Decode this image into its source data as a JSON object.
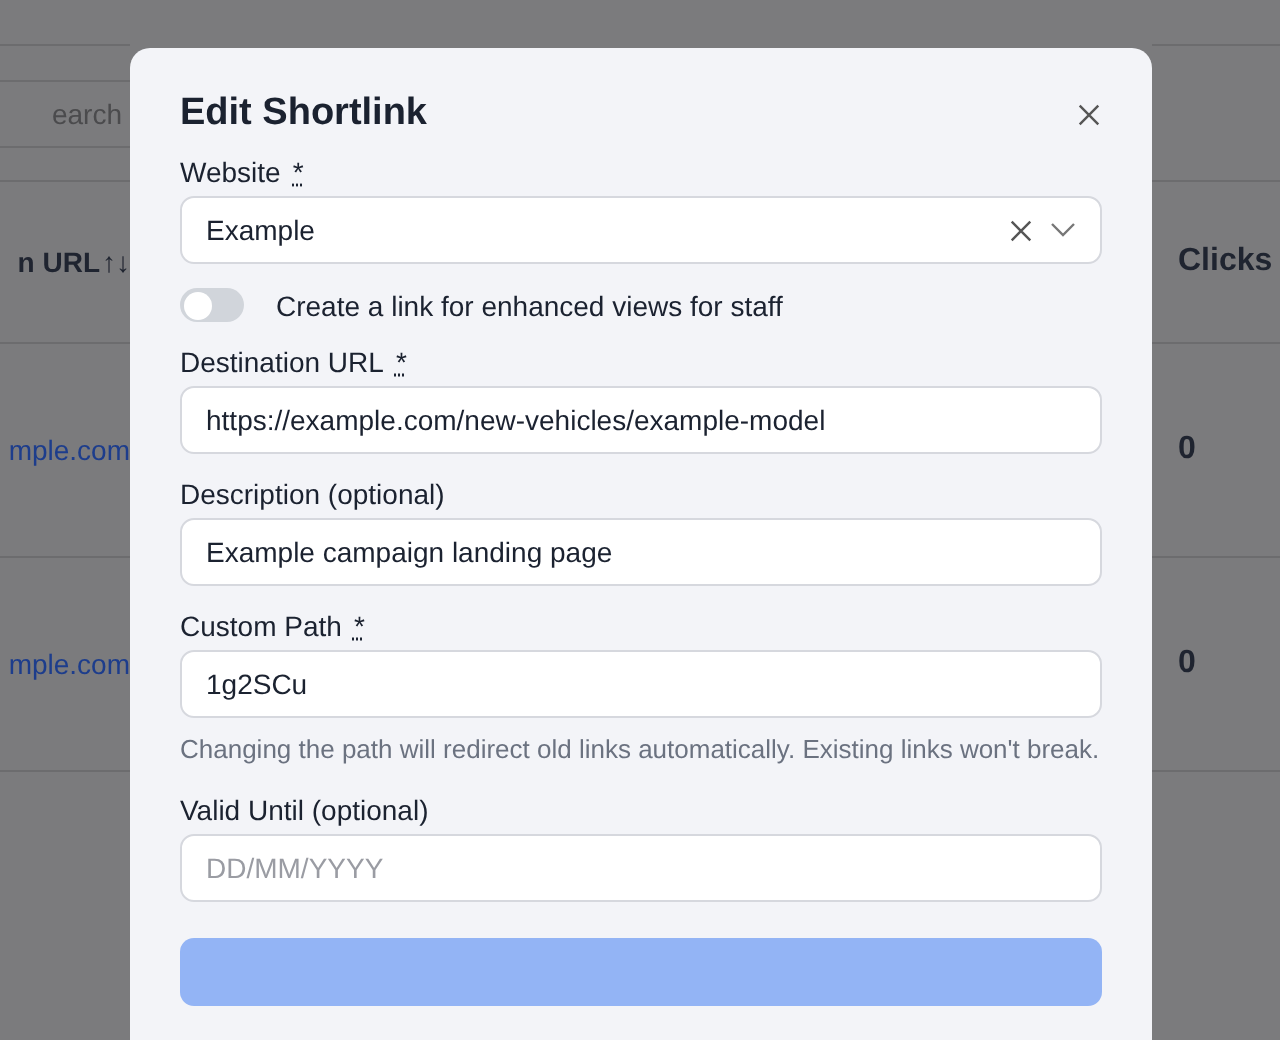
{
  "background_page": {
    "search": {
      "placeholder": "earch"
    },
    "table": {
      "columns": [
        {
          "label": "n URL",
          "sort_icon": "↑↓"
        },
        {
          "label": "Clicks"
        }
      ],
      "rows": [
        {
          "url": "mple.com",
          "clicks": "0"
        },
        {
          "url": "mple.com",
          "clicks": "0"
        }
      ]
    }
  },
  "dialog": {
    "title": "Edit Shortlink",
    "fields": [
      {
        "kind": "select",
        "label": "Website",
        "required": true,
        "value": "Example"
      },
      {
        "kind": "toggle",
        "label": "Create a link for enhanced views for staff",
        "on": false
      },
      {
        "kind": "text",
        "label": "Destination URL",
        "required": true,
        "value": "https://example.com/new-vehicles/example-model"
      },
      {
        "kind": "text",
        "label": "Description (optional)",
        "required": false,
        "value": "Example campaign landing page"
      },
      {
        "kind": "text",
        "label": "Custom Path",
        "required": true,
        "value": "1g2SCu",
        "help": "Changing the path will redirect old links automatically. Existing links won't break."
      },
      {
        "kind": "text",
        "label": "Valid Until (optional)",
        "required": false,
        "placeholder": "DD/MM/YYYY"
      }
    ],
    "required_mark": "*"
  }
}
